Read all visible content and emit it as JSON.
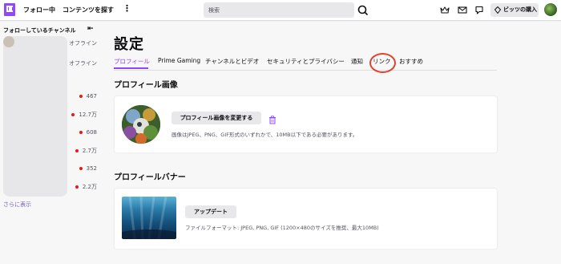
{
  "topbar": {
    "following": "フォロー中",
    "browse": "コンテンツを探す",
    "more": "⋮",
    "search_placeholder": "検索",
    "get_bits": "ビッツの購入"
  },
  "sidebar": {
    "title": "フォローしているチャンネル",
    "collapse": "⇤",
    "rows": [
      {
        "text": "オフライン",
        "live": false
      },
      {
        "text": "オフライン",
        "live": false
      },
      {
        "text": "467",
        "live": true
      },
      {
        "text": "12.7万",
        "live": true
      },
      {
        "text": "608",
        "live": true
      },
      {
        "text": "2.7万",
        "live": true
      },
      {
        "text": "352",
        "live": true
      },
      {
        "text": "2.2万",
        "live": true
      }
    ],
    "see_more": "さらに表示"
  },
  "main": {
    "title": "設定",
    "tabs": [
      "プロフィール",
      "Prime Gaming",
      "チャンネルとビデオ",
      "セキュリティとプライバシー",
      "通知",
      "リンク",
      "おすすめ"
    ],
    "profile_image": {
      "heading": "プロフィール画像",
      "button": "プロフィール画像を変更する",
      "hint": "画像はJPEG、PNG、GIF形式のいずれかで、10MB以下である必要があります。"
    },
    "profile_banner": {
      "heading": "プロフィールバナー",
      "button": "アップデート",
      "hint": "ファイルフォーマット: JPEG, PNG, GIF (1200×480のサイズを推奨、最大10MB)"
    }
  },
  "colors": {
    "accent": "#9147ff",
    "live_dot": "#e91916",
    "annotation": "#e1422c"
  },
  "icons": [
    "twitch-logo-icon",
    "kebab-icon",
    "search-icon",
    "crown-icon",
    "mail-icon",
    "chat-icon",
    "bits-gem-icon",
    "collapse-icon",
    "trash-icon"
  ]
}
